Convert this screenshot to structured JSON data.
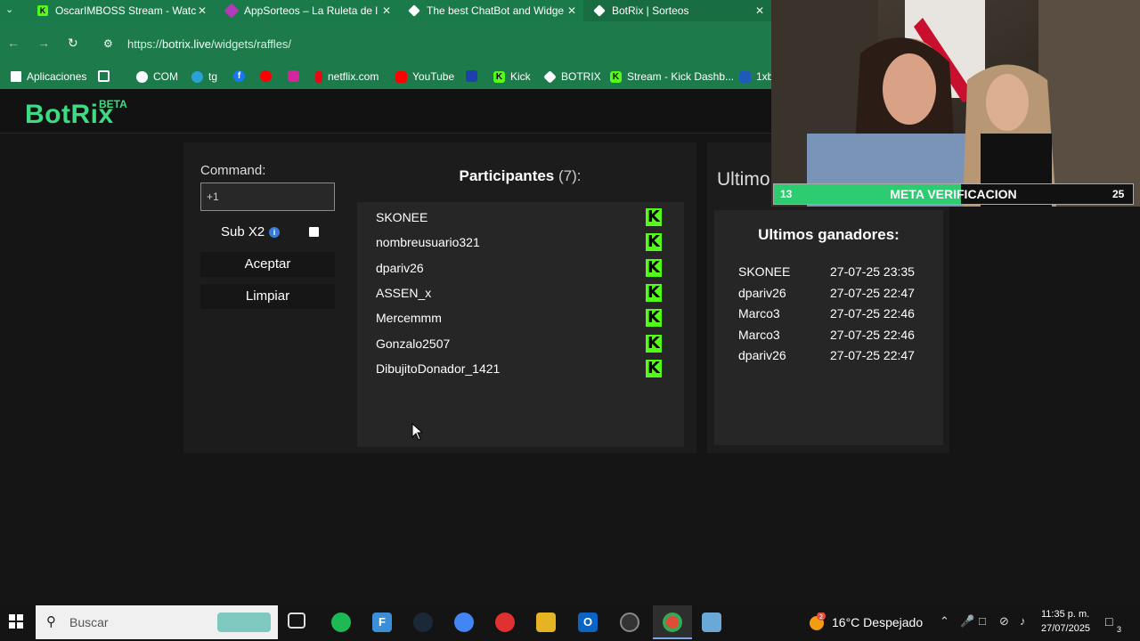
{
  "browser": {
    "tabs": [
      {
        "title": "OscarIMBOSS Stream - Watc",
        "icon_color": "#53fc18",
        "icon_glyph": "K"
      },
      {
        "title": "AppSorteos – La Ruleta de l",
        "icon_color": "#b33ab8",
        "icon_glyph": ""
      },
      {
        "title": "The best ChatBot and Widge",
        "icon_color": "#ffffff",
        "icon_glyph": ""
      },
      {
        "title": "BotRix | Sorteos",
        "icon_color": "#ffffff",
        "icon_glyph": ""
      }
    ],
    "url_prefix": "https://",
    "url_host": "botrix.live",
    "url_path": "/widgets/raffles/",
    "bookmarks": [
      {
        "label": "Aplicaciones",
        "icon": "apps-grid-icon"
      },
      {
        "label": "",
        "icon": "grid-icon"
      },
      {
        "label": "COM",
        "icon": "globe-icon"
      },
      {
        "label": "tg",
        "icon": "telegram-icon"
      },
      {
        "label": "",
        "icon": "facebook-icon"
      },
      {
        "label": "",
        "icon": "youtube-icon"
      },
      {
        "label": "",
        "icon": "instagram-icon"
      },
      {
        "label": "netflix.com",
        "icon": "netflix-icon"
      },
      {
        "label": "YouTube",
        "icon": "youtube-icon"
      },
      {
        "label": "",
        "icon": "dx-icon"
      },
      {
        "label": "Kick",
        "icon": "kick-icon"
      },
      {
        "label": "BOTRIX",
        "icon": "botrix-icon"
      },
      {
        "label": "Stream - Kick Dashb...",
        "icon": "kick-icon"
      },
      {
        "label": "1xb",
        "icon": "1xbet-icon"
      }
    ]
  },
  "site": {
    "logo": "BotRix",
    "beta": "BETA"
  },
  "raffle": {
    "command_label": "Command:",
    "command_value": "+1",
    "sub_label": "Sub X2",
    "accept_label": "Aceptar",
    "clear_label": "Limpiar",
    "participants_title": "Participantes",
    "participants_count": "(7):",
    "participants": [
      "SKONEE",
      "nombreusuario321",
      "dpariv26",
      "ASSEN_x",
      "Mercemmm",
      "Gonzalo2507",
      "DibujitoDonador_1421"
    ],
    "kick_glyph": "K"
  },
  "winners": {
    "side_heading": "Ultimo",
    "title": "Ultimos ganadores:",
    "rows": [
      {
        "name": "SKONEE",
        "date": "27-07-25 23:35"
      },
      {
        "name": "dpariv26",
        "date": "27-07-25 22:47"
      },
      {
        "name": "Marco3",
        "date": "27-07-25 22:46"
      },
      {
        "name": "Marco3",
        "date": "27-07-25 22:46"
      },
      {
        "name": "dpariv26",
        "date": "27-07-25 22:47"
      }
    ]
  },
  "overlay": {
    "left_value": "13",
    "label": "META VERIFICACION",
    "right_value": "25",
    "progress": 0.52,
    "bar_color": "#2ecc71"
  },
  "taskbar": {
    "search_placeholder": "Buscar",
    "weather": "16°C  Despejado",
    "time": "11:35 p. m.",
    "date": "27/07/2025",
    "notification_count": "3",
    "weather_badge": "2"
  }
}
